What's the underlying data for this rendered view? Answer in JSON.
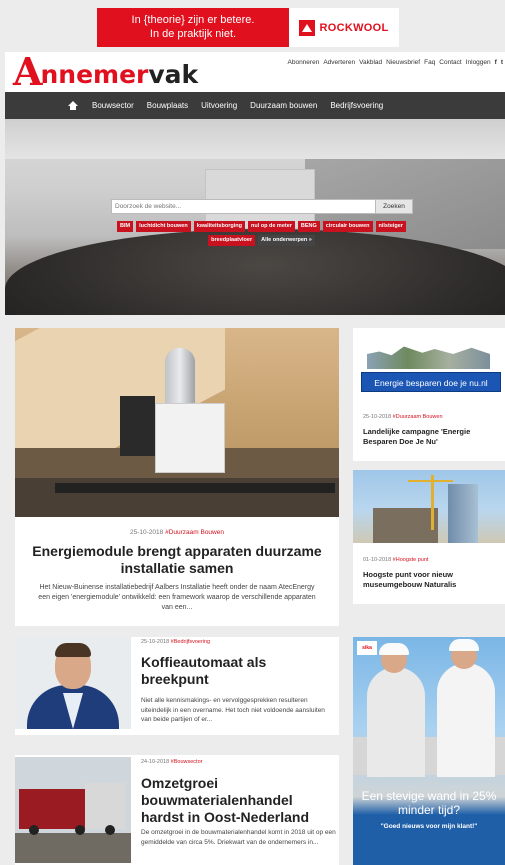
{
  "ad_top": {
    "line1": "In {theorie} zijn er betere.",
    "line2": "In de praktijk niet.",
    "brand": "ROCKWOOL",
    "brand_color": "#e0101e"
  },
  "header": {
    "logo_a": "A",
    "logo_nnemer": "nnemer",
    "logo_vak": "vak",
    "links": [
      "Abonneren",
      "Adverteren",
      "Vakblad",
      "Nieuwsbrief",
      "Faq",
      "Contact",
      "Inloggen",
      "f",
      "t"
    ]
  },
  "nav": {
    "home_icon": "home-icon",
    "items": [
      "Bouwsector",
      "Bouwplaats",
      "Uitvoering",
      "Duurzaam bouwen",
      "Bedrijfsvoering"
    ]
  },
  "search": {
    "placeholder": "Doorzoek de website...",
    "button": "Zoeken"
  },
  "tags": [
    "BIM",
    "luchtdicht bouwen",
    "kwaliteitsborging",
    "nul op de meter",
    "BENG",
    "circulair bouwen",
    "nilsteiger",
    "breedplaatvloer",
    "Alle onderwerpen »"
  ],
  "feature": {
    "date": "25-10-2018",
    "category": "#Duurzaam Bouwen",
    "title": "Energiemodule brengt apparaten duurzame installatie samen",
    "excerpt": "Het Nieuw-Buinense installatiebedrijf Aalbers Installatie heeft onder de naam AtecEnergy een eigen 'energiemodule' ontwikkeld: een framework waarop de verschillende apparaten van een..."
  },
  "side_cards": [
    {
      "image_text": "Energie besparen doe je nu.nl",
      "date": "25-10-2018",
      "category": "#Duurzaam Bouwen",
      "title": "Landelijke campagne 'Energie Besparen Doe Je Nu'"
    },
    {
      "date": "01-10-2018",
      "category": "#Hoogste punt",
      "title": "Hoogste punt voor nieuw museumgebouw Naturalis"
    }
  ],
  "list": [
    {
      "date": "25-10-2018",
      "category": "#Bedrijfsvoering",
      "title": "Koffieautomaat als breekpunt",
      "excerpt": "Niet alle kennismakings- en vervolggesprekken resulteren uiteindelijk in een overname. Het toch niet voldoende aansluiten van beide partijen of er..."
    },
    {
      "date": "24-10-2018",
      "category": "#Bouwsector",
      "title": "Omzetgroei bouwmaterialenhandel hardst in Oost-Nederland",
      "excerpt": "De omzetgroei in de bouwmaterialenhandel komt in 2018 uit op een gemiddelde van circa 5%. Driekwart van de ondernemers in..."
    }
  ],
  "ad_side": {
    "brand": "sika",
    "headline": "Een stevige wand in 25% minder tijd?",
    "quote": "\"Goed nieuws voor mijn klant!\""
  }
}
